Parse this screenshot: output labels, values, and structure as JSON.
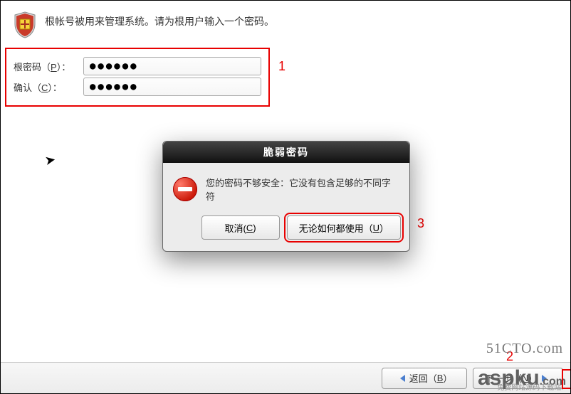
{
  "header": {
    "icon": "shield-icon",
    "text": "根帐号被用来管理系统。请为根用户输入一个密码。"
  },
  "form": {
    "password_label_pre": "根密码（",
    "password_label_key": "P",
    "password_label_post": "）：",
    "password_value": "●●●●●●",
    "confirm_label_pre": "确认（",
    "confirm_label_key": "C",
    "confirm_label_post": "）：",
    "confirm_value": "●●●●●●"
  },
  "annotations": {
    "a1": "1",
    "a2": "2",
    "a3": "3"
  },
  "modal": {
    "title": "脆弱密码",
    "message": "您的密码不够安全：它没有包含足够的不同字符",
    "cancel_pre": "取消(",
    "cancel_key": "C",
    "cancel_post": ")",
    "use_pre": "无论如何都使用（",
    "use_key": "U",
    "use_post": "）"
  },
  "footer": {
    "back_pre": "返回（",
    "back_key": "B",
    "back_post": "）",
    "next_pre": "下一步（",
    "next_key": "N",
    "next_post": "）"
  },
  "watermarks": {
    "w1": "51CTO.com",
    "w2": "aspku",
    "w2_suffix": ".com",
    "w2_sub": "免费网站源码下载站!"
  }
}
